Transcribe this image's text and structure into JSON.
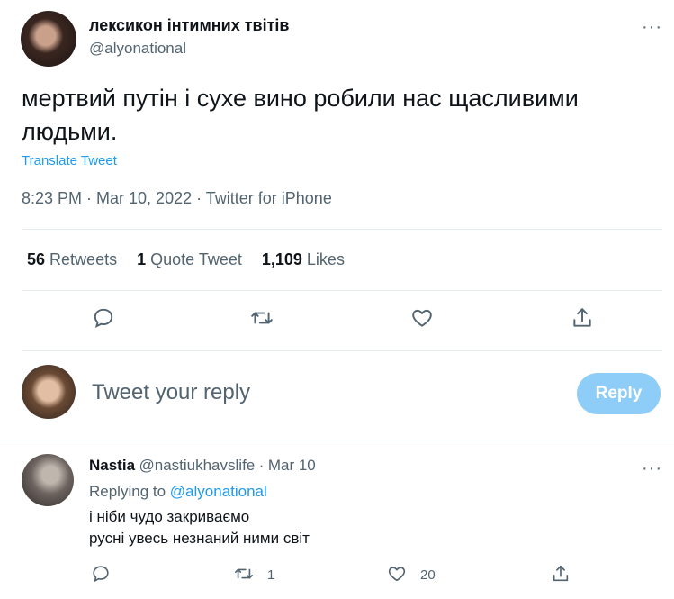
{
  "tweet": {
    "display_name": "лексикон інтимних твітів",
    "handle": "@alyonational",
    "text": "мертвий путін і сухе вино робили нас щасливими людьми.",
    "translate_label": "Translate Tweet",
    "meta": "8:23 PM · Mar 10, 2022 · Twitter for iPhone",
    "stats": {
      "retweets_count": "56",
      "retweets_label": "Retweets",
      "quotes_count": "1",
      "quotes_label": "Quote Tweet",
      "likes_count": "1,109",
      "likes_label": "Likes"
    },
    "more_icon": "···"
  },
  "composer": {
    "placeholder": "Tweet your reply",
    "button_label": "Reply"
  },
  "reply": {
    "name": "Nastia",
    "handle": "@nastiukhavslife",
    "separator": "·",
    "date": "Mar 10",
    "replying_to_label": "Replying to",
    "replying_to_handle": "@alyonational",
    "line1": "і ніби чудо закриваємо",
    "line2": "русні увесь незнаний ними світ",
    "retweet_count": "1",
    "like_count": "20",
    "more_icon": "···"
  },
  "colors": {
    "accent": "#1d9bf0",
    "reply_button": "#8ecdf8",
    "muted": "#536471"
  }
}
